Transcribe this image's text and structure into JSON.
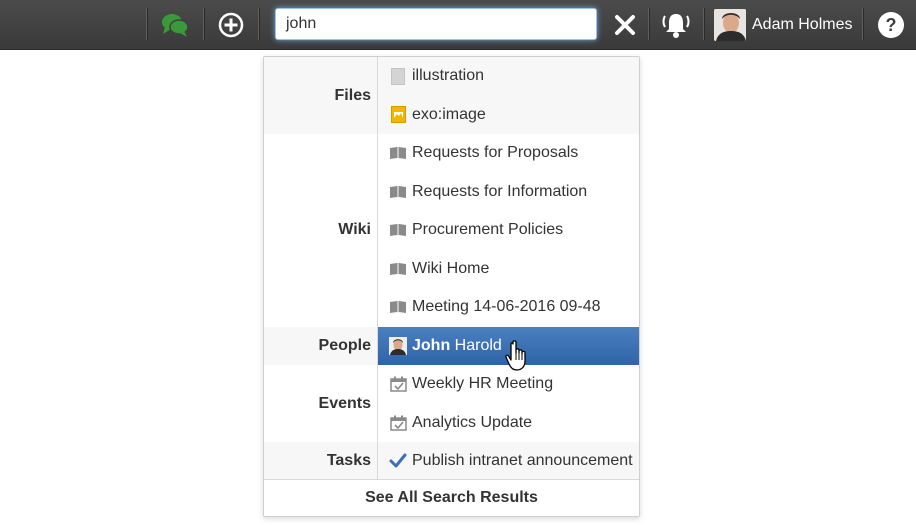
{
  "search": {
    "query": "john"
  },
  "user": {
    "name": "Adam Holmes"
  },
  "results": {
    "files": {
      "label": "Files",
      "items": [
        "illustration",
        "exo:image"
      ]
    },
    "wiki": {
      "label": "Wiki",
      "items": [
        "Requests for Proposals",
        "Requests for Information",
        "Procurement Policies",
        "Wiki Home",
        "Meeting 14-06-2016 09-48"
      ]
    },
    "people": {
      "label": "People",
      "items": [
        {
          "first": "John",
          "last": " Harold"
        }
      ]
    },
    "events": {
      "label": "Events",
      "items": [
        "Weekly HR Meeting",
        "Analytics Update"
      ]
    },
    "tasks": {
      "label": "Tasks",
      "items": [
        "Publish intranet announcement"
      ]
    }
  },
  "see_all_label": "See All Search Results",
  "colors": {
    "topbar": "#404040",
    "chat_green": "#3a9a3a",
    "selected_row": "#3a6fb3",
    "check_blue": "#3b6fb6"
  },
  "icons": {
    "chat": "chat-bubbles-icon",
    "add": "plus-circle-icon",
    "clear": "close-icon",
    "notifications": "bell-icon",
    "help": "help-icon"
  }
}
